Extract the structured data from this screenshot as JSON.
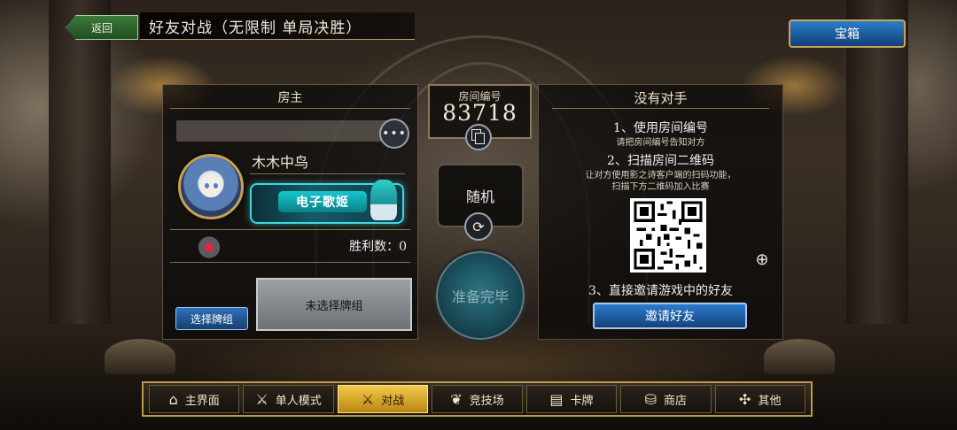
{
  "header": {
    "back_label": "返回",
    "title": "好友对战（无限制 单局决胜）",
    "treasure_label": "宝箱"
  },
  "host": {
    "panel_title": "房主",
    "chat_icon": "speech-bubble-icon",
    "player_name": "木木中鸟",
    "title_badge_text": "电子歌姬",
    "win_count": "胜利数：0",
    "select_deck_label": "选择牌组",
    "deck_placeholder": "未选择牌组"
  },
  "room": {
    "label": "房间编号",
    "number": "83718",
    "random_label": "随机",
    "ready_label": "准备完毕"
  },
  "opponent": {
    "panel_title": "没有对手",
    "step1": "1、使用房间编号",
    "step1_hint": "请把房间编号告知对方",
    "step2": "2、扫描房间二维码",
    "step2_hint_a": "让对方使用影之诗客户端的扫码功能，",
    "step2_hint_b": "扫描下方二维码加入比赛",
    "step3": "3、直接邀请游戏中的好友",
    "invite_label": "邀请好友"
  },
  "nav": {
    "tabs": [
      {
        "label": "主界面",
        "icon": "home-icon",
        "active": false
      },
      {
        "label": "单人模式",
        "icon": "crossed-swords-icon",
        "active": false
      },
      {
        "label": "对战",
        "icon": "versus-icon",
        "active": true
      },
      {
        "label": "竞技场",
        "icon": "laurel-icon",
        "active": false
      },
      {
        "label": "卡牌",
        "icon": "cards-icon",
        "active": false
      },
      {
        "label": "商店",
        "icon": "shop-icon",
        "active": false
      },
      {
        "label": "其他",
        "icon": "misc-icon",
        "active": false
      }
    ]
  },
  "colors": {
    "accent_blue": "#2b7bd0",
    "gold": "#c7a55a",
    "active_tab": "#f2c94a",
    "badge_cyan": "#19c6cf"
  }
}
